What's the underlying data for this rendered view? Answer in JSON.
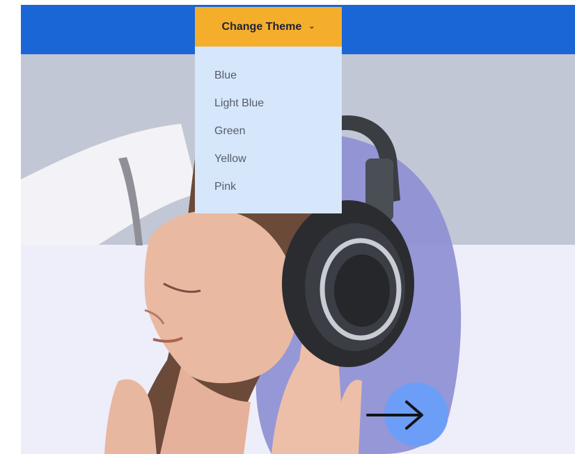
{
  "header": {
    "theme_button_label": "Change Theme",
    "theme_button_icon": "chevron-down-icon",
    "theme_menu": {
      "items": [
        "Blue",
        "Light Blue",
        "Green",
        "Yellow",
        "Pink"
      ]
    }
  },
  "hero": {
    "image": "woman-with-headphones",
    "next_button_icon": "arrow-right-icon"
  },
  "colors": {
    "header_bar": "#1a66d6",
    "theme_button": "#f5ae2c",
    "menu_background": "#d7e7fb",
    "hero_upper": "#c1c7d4",
    "hero_lower": "#eeedfa",
    "arrow_button": "#6d9ef7"
  }
}
